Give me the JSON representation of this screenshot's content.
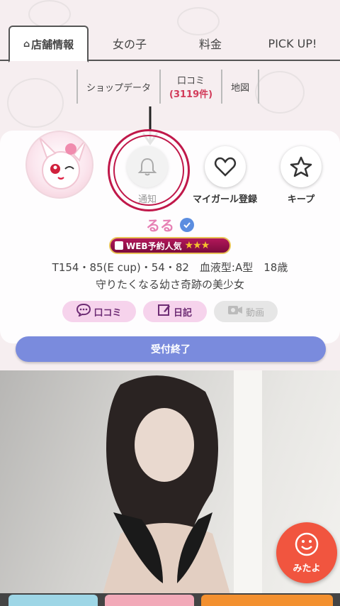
{
  "tabs": [
    {
      "label": "店舗情報",
      "active": true
    },
    {
      "label": "女の子",
      "active": false
    },
    {
      "label": "料金",
      "active": false
    },
    {
      "label": "PICK UP!",
      "active": false
    }
  ],
  "subtabs": {
    "shop_data": "ショップデータ",
    "reviews_label": "口コミ",
    "reviews_count": "(3119件)",
    "map": "地図"
  },
  "actions": {
    "notify": "通知",
    "my_girl": "マイガール登録",
    "keep": "キープ"
  },
  "profile": {
    "name": "るる",
    "badge_text": "WEB予約人気",
    "badge_stars": 2.5,
    "specs": "T154・85(E cup)・54・82　血液型:A型　18歳",
    "catchphrase": "守りたくなる幼さ奇跡の美少女"
  },
  "pills": {
    "reviews": "口コミ",
    "diary": "日記",
    "video": "動画"
  },
  "status_button": "受付終了",
  "mitayo_label": "みたよ",
  "colors": {
    "accent_pink": "#e680b4",
    "review_count": "#d23b5a",
    "status_button": "#7a8bdd",
    "mitayo": "#f1553f",
    "highlight_ring": "#c0184a"
  }
}
